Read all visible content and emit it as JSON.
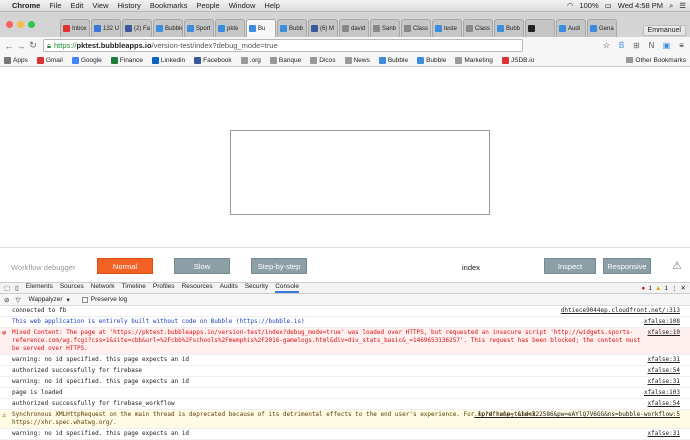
{
  "menubar": {
    "app": "Chrome",
    "items": [
      "File",
      "Edit",
      "View",
      "History",
      "Bookmarks",
      "People",
      "Window",
      "Help"
    ],
    "battery": "100%",
    "clock": "Wed 4:58 PM"
  },
  "tabs": [
    {
      "label": "Inbox",
      "color": "#d33"
    },
    {
      "label": "132 U",
      "color": "#3a78d8"
    },
    {
      "label": "(2) Fa",
      "color": "#3b5998"
    },
    {
      "label": "Bubble",
      "color": "#3b8de0"
    },
    {
      "label": "Sport",
      "color": "#3b8de0"
    },
    {
      "label": "pkte",
      "color": "#3b8de0"
    },
    {
      "label": "Bu",
      "color": "#3b8de0"
    },
    {
      "label": "Bubb",
      "color": "#3b8de0"
    },
    {
      "label": "(6) M",
      "color": "#3b5998"
    },
    {
      "label": "david",
      "color": "#888"
    },
    {
      "label": "Sanb",
      "color": "#888"
    },
    {
      "label": "Class",
      "color": "#888"
    },
    {
      "label": "teste",
      "color": "#3b8de0"
    },
    {
      "label": "Class",
      "color": "#888"
    },
    {
      "label": "Bubb",
      "color": "#3b8de0"
    },
    {
      "label": "",
      "color": "#222"
    },
    {
      "label": "Audi",
      "color": "#3b8de0"
    },
    {
      "label": "Gena",
      "color": "#3b8de0"
    }
  ],
  "active_tab": 6,
  "user": "Emmanuel",
  "url": {
    "scheme": "https://",
    "host": "pktest.bubbleapps.io",
    "path": "/version-test/index?debug_mode=true"
  },
  "bookmarks": [
    {
      "label": "Apps",
      "color": "#777"
    },
    {
      "label": "Gmail",
      "color": "#d33"
    },
    {
      "label": "Google",
      "color": "#4285f4"
    },
    {
      "label": "Finance",
      "color": "#1a7f37"
    },
    {
      "label": "Linkedin",
      "color": "#0a66c2"
    },
    {
      "label": "Facebook",
      "color": "#3b5998"
    },
    {
      "label": ".org",
      "color": "#999"
    },
    {
      "label": "Banque",
      "color": "#999"
    },
    {
      "label": "Dicos",
      "color": "#999"
    },
    {
      "label": "News",
      "color": "#999"
    },
    {
      "label": "Bubble",
      "color": "#3b8de0"
    },
    {
      "label": "Bubble",
      "color": "#3b8de0"
    },
    {
      "label": "Marketing",
      "color": "#999"
    },
    {
      "label": "JSDB.io",
      "color": "#d33"
    }
  ],
  "other_bookmarks": "Other Bookmarks",
  "debugger": {
    "title": "Workflow debugger",
    "normal": "Normal",
    "slow": "Slow",
    "step": "Step-by-step",
    "page": "index",
    "inspect": "Inspect",
    "responsive": "Responsive"
  },
  "devtools": {
    "tabs": [
      "Elements",
      "Sources",
      "Network",
      "Timeline",
      "Profiles",
      "Resources",
      "Audits",
      "Security",
      "Console"
    ],
    "active": "Console",
    "context": "Wappalyzer",
    "preserve": "Preserve log",
    "errors": "1",
    "warnings": "1"
  },
  "console": [
    {
      "type": "log",
      "text": "connected to fb",
      "src": "dhtiece9044ep.cloudfront.net/:313"
    },
    {
      "type": "info",
      "text": "This web application is entirely built without code on Bubble (https://bubble.is)",
      "src": "xfalse:108"
    },
    {
      "type": "error",
      "text": "Mixed Content: The page at 'https://pktest.bubbleapps.io/version-test/index?debug_mode=true' was loaded over HTTPS, but requested an insecure script 'http://widgets.sports-reference.com/wg.fcgi?css=1&site=cbb&url=%2Fcbb%2Fschools%2Fmemphis%2F2016-gamelogs.html&div=div_stats_basic&_=1469653136257'. This request has been blocked; the content must be served over HTTPS.",
      "src": "xfalse:10"
    },
    {
      "type": "log",
      "text": "warning: no id specified.  this page expects an id",
      "src": "xfalse:31"
    },
    {
      "type": "log",
      "text": "authorized successfully for firebase",
      "src": "xfalse:54"
    },
    {
      "type": "log",
      "text": "warning: no id specified.  this page expects an id",
      "src": "xfalse:31"
    },
    {
      "type": "log",
      "text": "page is loaded",
      "src": "xfalse:103"
    },
    {
      "type": "log",
      "text": "authorized successfully for firebase_workflow",
      "src": "xfalse:54"
    },
    {
      "type": "warn",
      "text": "Synchronous XMLHttpRequest on the main thread is deprecated because of its detrimental effects to the end user's experience. For more help, check https://xhr.spec.whatwg.org/.",
      "src": ".lp?dframe=t&id=322586&pw=eAYlQ7V6GG&ns=bubble-workflow:5"
    },
    {
      "type": "log",
      "text": "warning: no id specified.  this page expects an id",
      "src": "xfalse:31"
    }
  ]
}
